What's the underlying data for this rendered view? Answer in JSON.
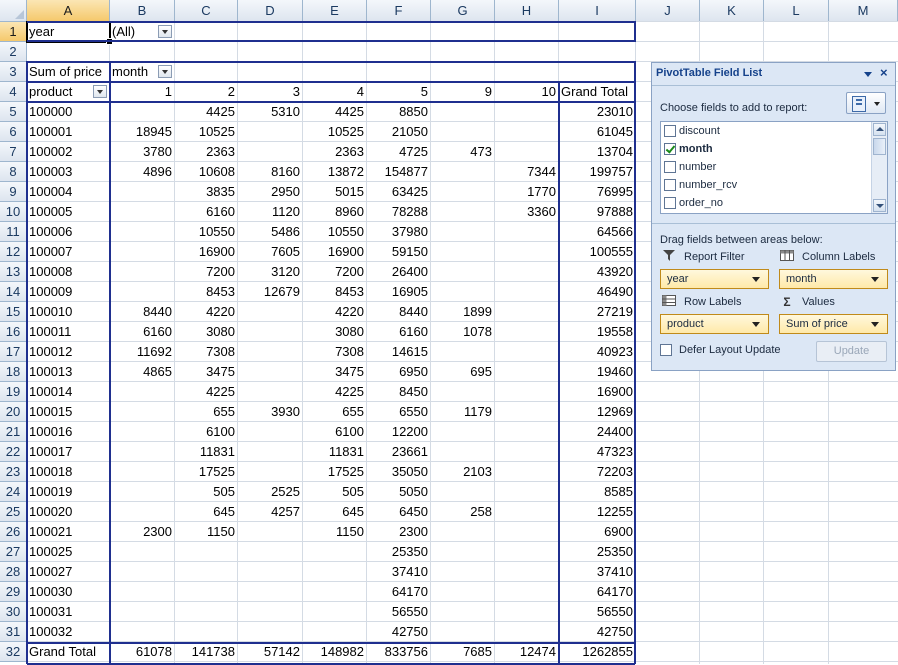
{
  "columns": [
    "A",
    "B",
    "C",
    "D",
    "E",
    "F",
    "G",
    "H",
    "I",
    "J",
    "K",
    "L",
    "M"
  ],
  "rows": [
    "1",
    "2",
    "3",
    "4",
    "5",
    "6",
    "7",
    "8",
    "9",
    "10",
    "11",
    "12",
    "13",
    "14",
    "15",
    "16",
    "17",
    "18",
    "19",
    "20",
    "21",
    "22",
    "23",
    "24",
    "25",
    "26",
    "27",
    "28",
    "29",
    "30",
    "31",
    "32"
  ],
  "filter": {
    "label": "year",
    "value": "(All)"
  },
  "pivot_header": {
    "sum_label": "Sum of price",
    "col_field": "month",
    "row_field": "product",
    "grand_total": "Grand Total"
  },
  "months": [
    "1",
    "2",
    "3",
    "4",
    "5",
    "9",
    "10"
  ],
  "data_rows": [
    {
      "product": "100000",
      "vals": [
        "",
        "4425",
        "5310",
        "4425",
        "8850",
        "",
        ""
      ],
      "total": "23010"
    },
    {
      "product": "100001",
      "vals": [
        "18945",
        "10525",
        "",
        "10525",
        "21050",
        "",
        ""
      ],
      "total": "61045"
    },
    {
      "product": "100002",
      "vals": [
        "3780",
        "2363",
        "",
        "2363",
        "4725",
        "473",
        ""
      ],
      "total": "13704"
    },
    {
      "product": "100003",
      "vals": [
        "4896",
        "10608",
        "8160",
        "13872",
        "154877",
        "",
        "7344"
      ],
      "total": "199757"
    },
    {
      "product": "100004",
      "vals": [
        "",
        "3835",
        "2950",
        "5015",
        "63425",
        "",
        "1770"
      ],
      "total": "76995"
    },
    {
      "product": "100005",
      "vals": [
        "",
        "6160",
        "1120",
        "8960",
        "78288",
        "",
        "3360"
      ],
      "total": "97888"
    },
    {
      "product": "100006",
      "vals": [
        "",
        "10550",
        "5486",
        "10550",
        "37980",
        "",
        ""
      ],
      "total": "64566"
    },
    {
      "product": "100007",
      "vals": [
        "",
        "16900",
        "7605",
        "16900",
        "59150",
        "",
        ""
      ],
      "total": "100555"
    },
    {
      "product": "100008",
      "vals": [
        "",
        "7200",
        "3120",
        "7200",
        "26400",
        "",
        ""
      ],
      "total": "43920"
    },
    {
      "product": "100009",
      "vals": [
        "",
        "8453",
        "12679",
        "8453",
        "16905",
        "",
        ""
      ],
      "total": "46490"
    },
    {
      "product": "100010",
      "vals": [
        "8440",
        "4220",
        "",
        "4220",
        "8440",
        "1899",
        ""
      ],
      "total": "27219"
    },
    {
      "product": "100011",
      "vals": [
        "6160",
        "3080",
        "",
        "3080",
        "6160",
        "1078",
        ""
      ],
      "total": "19558"
    },
    {
      "product": "100012",
      "vals": [
        "11692",
        "7308",
        "",
        "7308",
        "14615",
        "",
        ""
      ],
      "total": "40923"
    },
    {
      "product": "100013",
      "vals": [
        "4865",
        "3475",
        "",
        "3475",
        "6950",
        "695",
        ""
      ],
      "total": "19460"
    },
    {
      "product": "100014",
      "vals": [
        "",
        "4225",
        "",
        "4225",
        "8450",
        "",
        ""
      ],
      "total": "16900"
    },
    {
      "product": "100015",
      "vals": [
        "",
        "655",
        "3930",
        "655",
        "6550",
        "1179",
        ""
      ],
      "total": "12969"
    },
    {
      "product": "100016",
      "vals": [
        "",
        "6100",
        "",
        "6100",
        "12200",
        "",
        ""
      ],
      "total": "24400"
    },
    {
      "product": "100017",
      "vals": [
        "",
        "11831",
        "",
        "11831",
        "23661",
        "",
        ""
      ],
      "total": "47323"
    },
    {
      "product": "100018",
      "vals": [
        "",
        "17525",
        "",
        "17525",
        "35050",
        "2103",
        ""
      ],
      "total": "72203"
    },
    {
      "product": "100019",
      "vals": [
        "",
        "505",
        "2525",
        "505",
        "5050",
        "",
        ""
      ],
      "total": "8585"
    },
    {
      "product": "100020",
      "vals": [
        "",
        "645",
        "4257",
        "645",
        "6450",
        "258",
        ""
      ],
      "total": "12255"
    },
    {
      "product": "100021",
      "vals": [
        "2300",
        "1150",
        "",
        "1150",
        "2300",
        "",
        ""
      ],
      "total": "6900"
    },
    {
      "product": "100025",
      "vals": [
        "",
        "",
        "",
        "",
        "25350",
        "",
        ""
      ],
      "total": "25350"
    },
    {
      "product": "100027",
      "vals": [
        "",
        "",
        "",
        "",
        "37410",
        "",
        ""
      ],
      "total": "37410"
    },
    {
      "product": "100030",
      "vals": [
        "",
        "",
        "",
        "",
        "64170",
        "",
        ""
      ],
      "total": "64170"
    },
    {
      "product": "100031",
      "vals": [
        "",
        "",
        "",
        "",
        "56550",
        "",
        ""
      ],
      "total": "56550"
    },
    {
      "product": "100032",
      "vals": [
        "",
        "",
        "",
        "",
        "42750",
        "",
        ""
      ],
      "total": "42750"
    }
  ],
  "grand_total_row": {
    "label": "Grand Total",
    "vals": [
      "61078",
      "141738",
      "57142",
      "148982",
      "833756",
      "7685",
      "12474"
    ],
    "total": "1262855"
  },
  "panel": {
    "title": "PivotTable Field List",
    "choose_label": "Choose fields to add to report:",
    "fields": [
      {
        "name": "discount",
        "checked": false
      },
      {
        "name": "month",
        "checked": true
      },
      {
        "name": "number",
        "checked": false
      },
      {
        "name": "number_rcv",
        "checked": false
      },
      {
        "name": "order_no",
        "checked": false
      }
    ],
    "drag_label": "Drag fields between areas below:",
    "report_filter_label": "Report Filter",
    "column_labels_label": "Column Labels",
    "row_labels_label": "Row Labels",
    "values_label": "Values",
    "report_filter_field": "year",
    "column_field": "month",
    "row_field": "product",
    "values_field": "Sum of price",
    "defer_label": "Defer Layout Update",
    "update_label": "Update",
    "values_icon": "Σ"
  }
}
